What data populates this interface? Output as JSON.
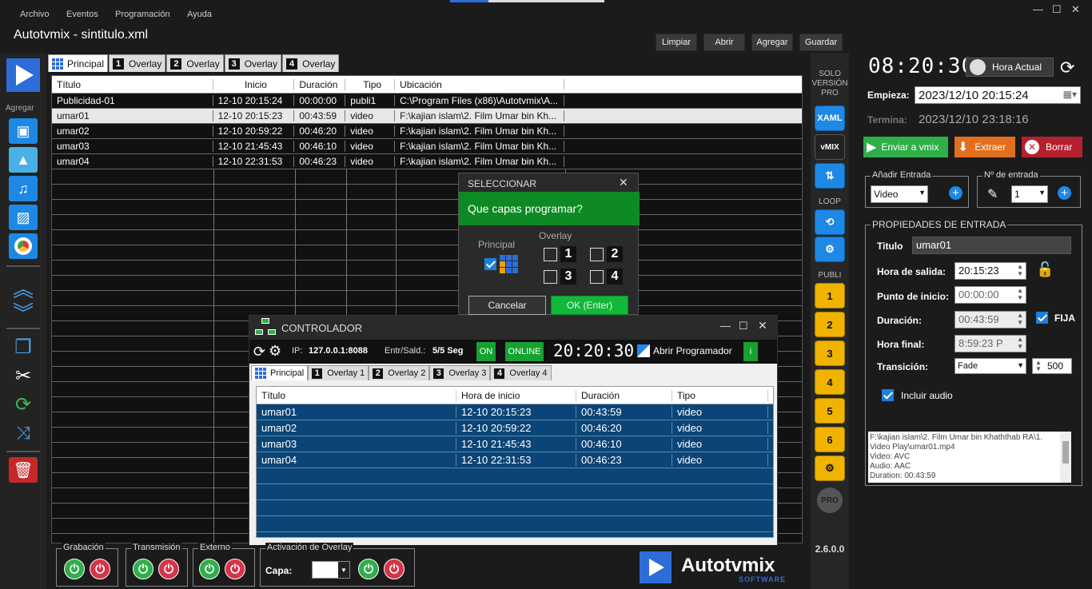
{
  "menu": [
    "Archivo",
    "Eventos",
    "Programación",
    "Ayuda"
  ],
  "window_title": "Autotvmix - sintitulo.xml",
  "toolbar": {
    "limpiar": "Limpiar",
    "abrir": "Abrir",
    "agregar": "Agregar",
    "guardar": "Guardar"
  },
  "left_sidebar": {
    "agregar_label": "Agregar",
    "icons": [
      "play-icon",
      "add-video-icon",
      "add-image-icon",
      "add-music-icon",
      "add-slideshow-icon",
      "add-chrome-icon",
      "move-up-icon",
      "move-down-icon",
      "copy-icon",
      "cut-icon",
      "refresh-icon",
      "shuffle-icon",
      "delete-icon"
    ]
  },
  "main_tabs": [
    {
      "num": "",
      "label": "Principal"
    },
    {
      "num": "1",
      "label": "Overlay"
    },
    {
      "num": "2",
      "label": "Overlay"
    },
    {
      "num": "3",
      "label": "Overlay"
    },
    {
      "num": "4",
      "label": "Overlay"
    }
  ],
  "main_table": {
    "headers": [
      "Título",
      "Inicio",
      "Duración",
      "Tipo",
      "Ubicación"
    ],
    "rows": [
      [
        "Publicidad-01",
        "12-10  20:15:24",
        "00:00:00",
        "publi1",
        "C:\\Program Files (x86)\\Autotvmix\\A..."
      ],
      [
        "umar01",
        "12-10  20:15:23",
        "00:43:59",
        "video",
        "F:\\kajian islam\\2. Film Umar bin Kh..."
      ],
      [
        "umar02",
        "12-10  20:59:22",
        "00:46:20",
        "video",
        "F:\\kajian islam\\2. Film Umar bin Kh..."
      ],
      [
        "umar03",
        "12-10  21:45:43",
        "00:46:10",
        "video",
        "F:\\kajian islam\\2. Film Umar bin Kh..."
      ],
      [
        "umar04",
        "12-10  22:31:53",
        "00:46:23",
        "video",
        "F:\\kajian islam\\2. Film Umar bin Kh..."
      ]
    ]
  },
  "right_strip": {
    "solo_version_pro": "SOLO VERSIÓN PRO",
    "xaml": "XAML",
    "vmix": "vMIX",
    "loop": "LOOP",
    "publi": "PUBLI",
    "publi_nums": [
      "1",
      "2",
      "3",
      "4",
      "5",
      "6"
    ],
    "pro": "PRO",
    "version": "2.6.0.0"
  },
  "clock": {
    "time": "08:20:30",
    "hora_actual": "Hora Actual"
  },
  "empieza": {
    "label": "Empieza:",
    "value": "2023/12/10 20:15:24"
  },
  "termina": {
    "label": "Termina:",
    "value": "2023/12/10 23:18:16"
  },
  "actions": {
    "enviar": "Enviar a vmix",
    "extraer": "Extraer",
    "borrar": "Borrar"
  },
  "anadir": {
    "label": "Añadir Entrada",
    "value": "Video"
  },
  "n_entrada": {
    "label": "Nº de entrada",
    "value": "1"
  },
  "propiedades": {
    "title": "PROPIEDADES DE ENTRADA",
    "titulo_label": "Titulo",
    "titulo": "umar01",
    "hora_salida_label": "Hora de salida:",
    "hora_salida": "20:15:23",
    "punto_inicio_label": "Punto de inicio:",
    "punto_inicio": "00:00:00",
    "duracion_label": "Duración:",
    "duracion": "00:43:59",
    "fija": "FIJA",
    "hora_final_label": "Hora final:",
    "hora_final": "8:59:23 P",
    "transicion_label": "Transición:",
    "transicion": "Fade",
    "transicion_ms": "500",
    "incluir_audio": "Incluir audio",
    "info": [
      "F:\\kajian islam\\2. Film Umar bin Khaththab RA\\1.",
      "Video Play\\umar01.mp4",
      "Video: AVC",
      "Audio: AAC",
      "Duration: 00:43:59"
    ]
  },
  "dialog_sel": {
    "title": "SELECCIONAR",
    "question": "Que capas programar?",
    "principal": "Principal",
    "overlay": "Overlay",
    "nums": [
      "1",
      "2",
      "3",
      "4"
    ],
    "cancel": "Cancelar",
    "ok": "OK (Enter)"
  },
  "controller": {
    "title": "CONTROLADOR",
    "ip_label": "IP:",
    "ip": "127.0.0.1:8088",
    "entr_label": "Entr/Sald.:",
    "entr": "5/5 Seg",
    "on": "ON",
    "online": "ONLINE",
    "time": "20:20:30",
    "abrir": "Abrir Programador",
    "info": "i",
    "tabs": [
      {
        "num": "",
        "label": "Principal"
      },
      {
        "num": "1",
        "label": "Overlay 1"
      },
      {
        "num": "2",
        "label": "Overlay 2"
      },
      {
        "num": "3",
        "label": "Overlay 3"
      },
      {
        "num": "4",
        "label": "Overlay 4"
      }
    ],
    "headers": [
      "Título",
      "Hora de inicio",
      "Duración",
      "Tipo"
    ],
    "rows": [
      [
        "umar01",
        "12-10  20:15:23",
        "00:43:59",
        "video"
      ],
      [
        "umar02",
        "12-10  20:59:22",
        "00:46:20",
        "video"
      ],
      [
        "umar03",
        "12-10  21:45:43",
        "00:46:10",
        "video"
      ],
      [
        "umar04",
        "12-10  22:31:53",
        "00:46:23",
        "video"
      ]
    ]
  },
  "bottom": {
    "grabacion": "Grabación",
    "transmision": "Transmisión",
    "externo": "Externo",
    "activacion": "Activación de Overlay",
    "capa": "Capa:"
  },
  "logo": {
    "name": "Autotvmix",
    "sub": "SOFTWARE"
  }
}
